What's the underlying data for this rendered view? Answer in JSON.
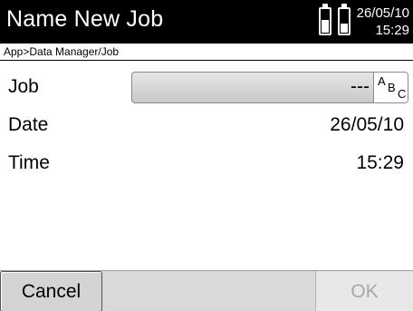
{
  "titlebar": {
    "title": "Name New Job",
    "date": "26/05/10",
    "time": "15:29"
  },
  "breadcrumb": "App>Data Manager/Job",
  "form": {
    "job": {
      "label": "Job",
      "value": "---"
    },
    "date": {
      "label": "Date",
      "value": "26/05/10"
    },
    "time": {
      "label": "Time",
      "value": "15:29"
    }
  },
  "abc_icon": {
    "a": "A",
    "b": "B",
    "c": "C"
  },
  "softkeys": {
    "cancel": "Cancel",
    "ok": "OK"
  },
  "icons": {
    "battery": "battery-icon",
    "abc": "text-input-icon"
  }
}
